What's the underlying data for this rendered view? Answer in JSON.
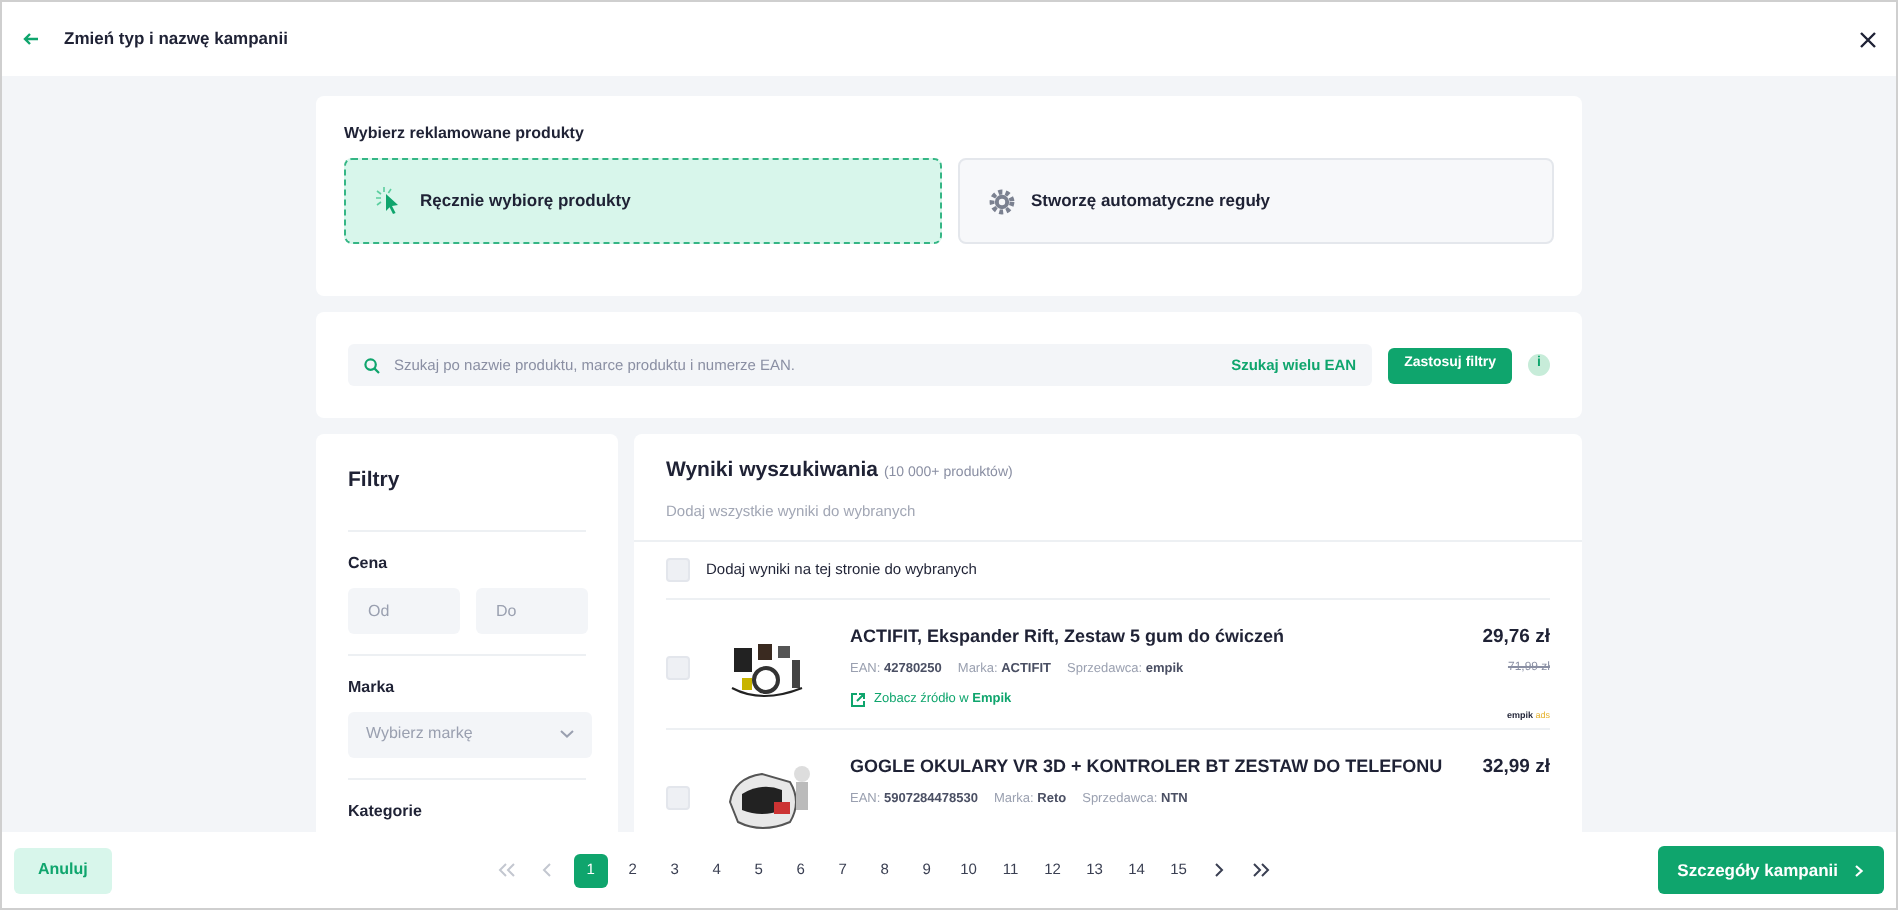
{
  "header": {
    "title": "Zmień typ i nazwę kampanii"
  },
  "product_choice": {
    "title": "Wybierz reklamowane produkty",
    "options": [
      {
        "kind": "manual",
        "label": "Ręcznie wybiorę produkty",
        "selected": true
      },
      {
        "kind": "auto",
        "label": "Stworzę automatyczne reguły",
        "selected": false
      }
    ]
  },
  "search": {
    "placeholder": "Szukaj po nazwie produktu, marce produktu i numerze EAN.",
    "multi_ean_link": "Szukaj wielu EAN",
    "apply_button": "Zastosuj filtry",
    "info_icon": "i"
  },
  "filters": {
    "title": "Filtry",
    "sections": [
      {
        "kind": "range",
        "label": "Cena",
        "from_placeholder": "Od",
        "to_placeholder": "Do"
      },
      {
        "kind": "select",
        "label": "Marka",
        "placeholder": "Wybierz markę"
      },
      {
        "kind": "heading",
        "label": "Kategorie"
      }
    ]
  },
  "results": {
    "title": "Wyniki wyszukiwania",
    "count": "(10 000+ produktów)",
    "add_all_link": "Dodaj wszystkie wyniki do wybranych",
    "add_page_label": "Dodaj wyniki na tej stronie do wybranych",
    "add_page_checked": false,
    "products": [
      {
        "name": "ACTIFIT, Ekspander Rift, Zestaw 5 gum do ćwiczeń",
        "meta": [
          "EAN: **42780250**",
          "Marka: **ACTIFIT**",
          "Sprzedawca: **empik**"
        ],
        "price": "29,76 zł",
        "old_price": "71,99 zł",
        "source_link": "Zobacz źródło w **Empik**",
        "logo": {
          "brand": "empik",
          "suffix": "ads"
        },
        "checked": false
      },
      {
        "name": "GOGLE OKULARY VR 3D + KONTROLER BT ZESTAW DO TELEFONU",
        "meta": [
          "EAN: **5907284478530**",
          "Marka: **Reto**",
          "Sprzedawca: **NTN**"
        ],
        "price": "32,99 zł",
        "checked": false
      }
    ]
  },
  "footer": {
    "cancel_button": "Anuluj",
    "next_button": "Szczegóły kampanii",
    "pagination": {
      "controls_before": [
        {
          "kind": "first",
          "disabled": true
        },
        {
          "kind": "prev",
          "disabled": true
        }
      ],
      "pages": [
        {
          "label": "1",
          "selected": true
        },
        {
          "label": "2",
          "selected": false
        },
        {
          "label": "3",
          "selected": false
        },
        {
          "label": "4",
          "selected": false
        },
        {
          "label": "5",
          "selected": false
        },
        {
          "label": "6",
          "selected": false
        },
        {
          "label": "7",
          "selected": false
        },
        {
          "label": "8",
          "selected": false
        },
        {
          "label": "9",
          "selected": false
        },
        {
          "label": "10",
          "selected": false
        },
        {
          "label": "11",
          "selected": false
        },
        {
          "label": "12",
          "selected": false
        },
        {
          "label": "13",
          "selected": false
        },
        {
          "label": "14",
          "selected": false
        },
        {
          "label": "15",
          "selected": false
        }
      ],
      "controls_after": [
        {
          "kind": "next",
          "disabled": false
        },
        {
          "kind": "last",
          "disabled": false
        }
      ]
    }
  }
}
